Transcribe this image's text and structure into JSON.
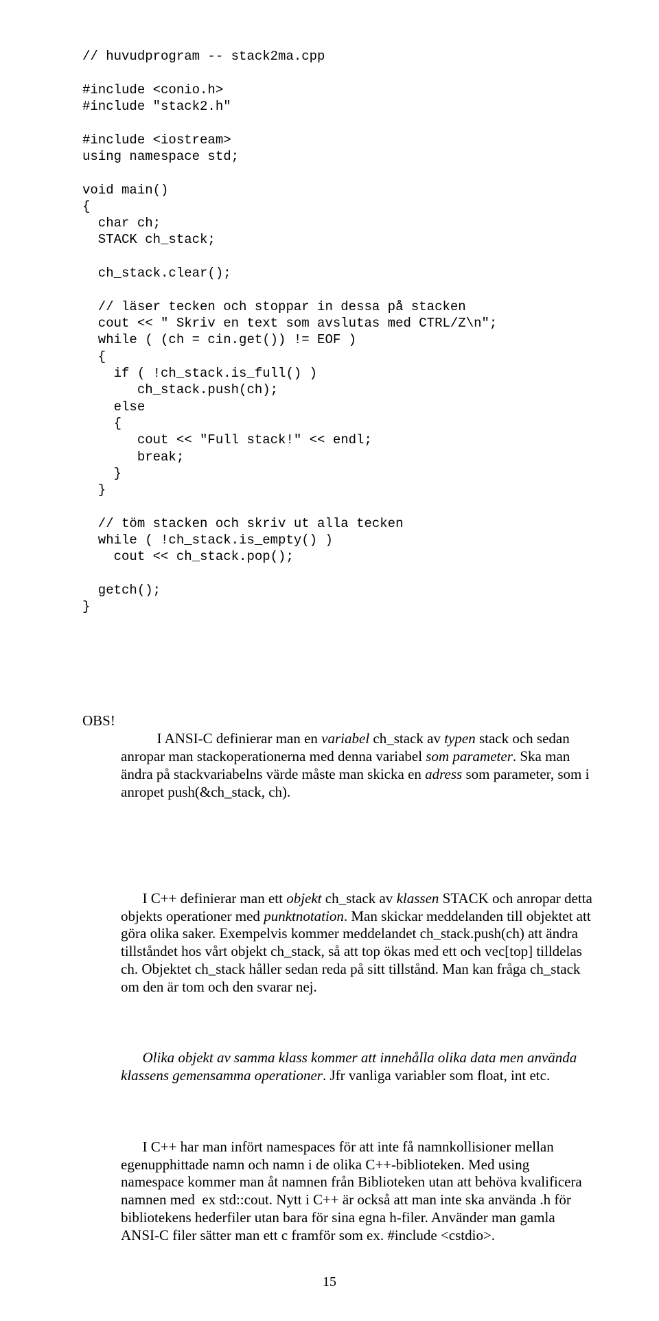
{
  "code": "// huvudprogram -- stack2ma.cpp\n\n#include <conio.h>\n#include \"stack2.h\"\n\n#include <iostream>\nusing namespace std;\n\nvoid main()\n{\n  char ch;\n  STACK ch_stack;\n\n  ch_stack.clear();\n\n  // läser tecken och stoppar in dessa på stacken\n  cout << \" Skriv en text som avslutas med CTRL/Z\\n\";\n  while ( (ch = cin.get()) != EOF )\n  {\n    if ( !ch_stack.is_full() )\n       ch_stack.push(ch);\n    else\n    {\n       cout << \"Full stack!\" << endl;\n       break;\n    }\n  }\n\n  // töm stacken och skriv ut alla tecken\n  while ( !ch_stack.is_empty() )\n    cout << ch_stack.pop();\n\n  getch();\n}",
  "obs_label": "OBS!",
  "p1a": "I ANSI-C definierar man en ",
  "p1b": "variabel",
  "p1c": " ch_stack av ",
  "p1d": "typen",
  "p1e": " stack och sedan anropar man stackoperationerna med denna variabel ",
  "p1f": "som parameter",
  "p1g": ". Ska man ändra på stackvariabelns värde måste man skicka en ",
  "p1h": "adress",
  "p1i": " som parameter, som i anropet push(&ch_stack, ch).",
  "p2a": "I C++ definierar man ett ",
  "p2b": "objekt",
  "p2c": " ch_stack av ",
  "p2d": "klassen",
  "p2e": " STACK och anropar detta objekts operationer med ",
  "p2f": "punktnotation",
  "p2g": ". Man skickar meddelanden till objektet att göra olika saker. Exempelvis kommer meddelandet ch_stack.push(ch) att ändra tillståndet hos vårt objekt ch_stack, så att top ökas med ett och vec[top] tilldelas ch. Objektet ch_stack håller sedan reda på sitt tillstånd. Man kan fråga ch_stack om den är tom och den svarar nej.",
  "p3a": "Olika objekt av samma klass kommer att innehålla olika data men använda klassens gemensamma operationer",
  "p3b": ". Jfr vanliga variabler som float, int etc.",
  "p4": "I C++ har man infört namespaces för att inte få namnkollisioner mellan egenupphittade namn och namn i de olika C++-biblioteken. Med using namespace kommer man åt namnen från Biblioteken utan att behöva kvalificera namnen med  ex std::cout. Nytt i C++ är också att man inte ska använda .h för bibliotekens hederfiler utan bara för sina egna h-filer. Använder man gamla ANSI-C filer sätter man ett c framför som ex. #include <cstdio>.",
  "page_number": "15"
}
